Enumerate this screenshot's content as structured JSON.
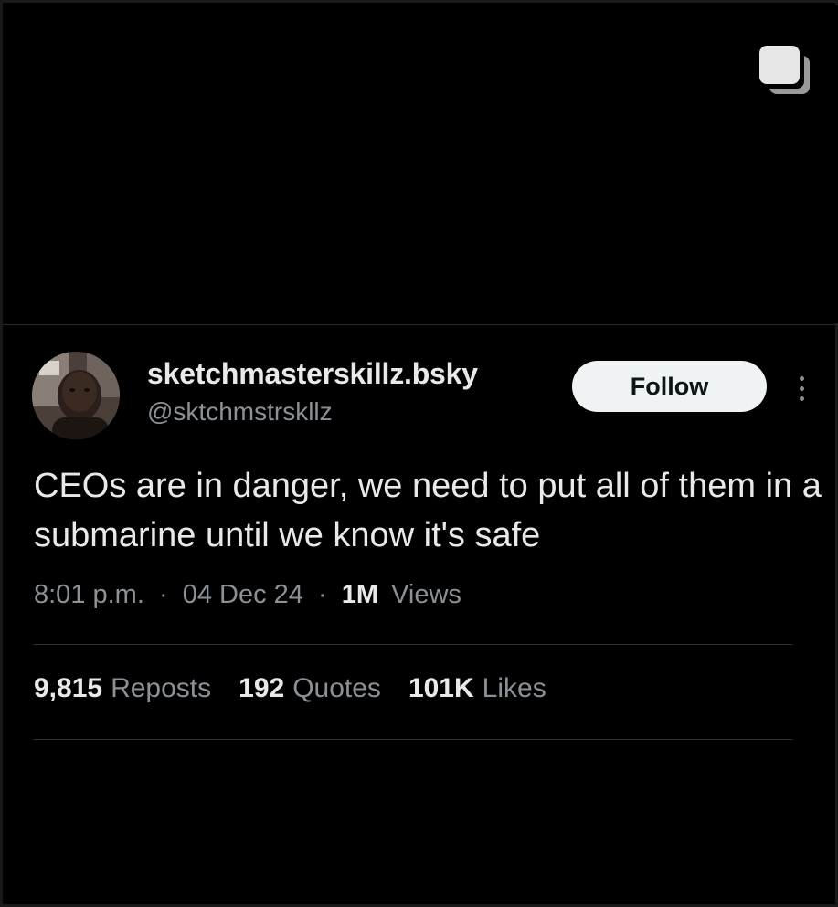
{
  "profile": {
    "display_name": "sketchmasterskillz.bsky",
    "handle": "@sktchmstrskllz",
    "follow_label": "Follow"
  },
  "tweet": {
    "text": "CEOs are in danger, we need to put all of them in a submarine until we know it's safe"
  },
  "meta": {
    "time": "8:01 p.m.",
    "separator": "·",
    "date": "04 Dec 24",
    "views_count": "1M",
    "views_label": "Views"
  },
  "stats": {
    "reposts_count": "9,815",
    "reposts_label": "Reposts",
    "quotes_count": "192",
    "quotes_label": "Quotes",
    "likes_count": "101K",
    "likes_label": "Likes"
  },
  "icons": {
    "multi_image": "multiple-images-icon",
    "more": "more-options-icon"
  },
  "colors": {
    "background": "#000000",
    "primary_text": "#e7e9ea",
    "secondary_text": "#8b9197",
    "follow_button_bg": "#eff3f4",
    "divider": "#2f3336"
  }
}
